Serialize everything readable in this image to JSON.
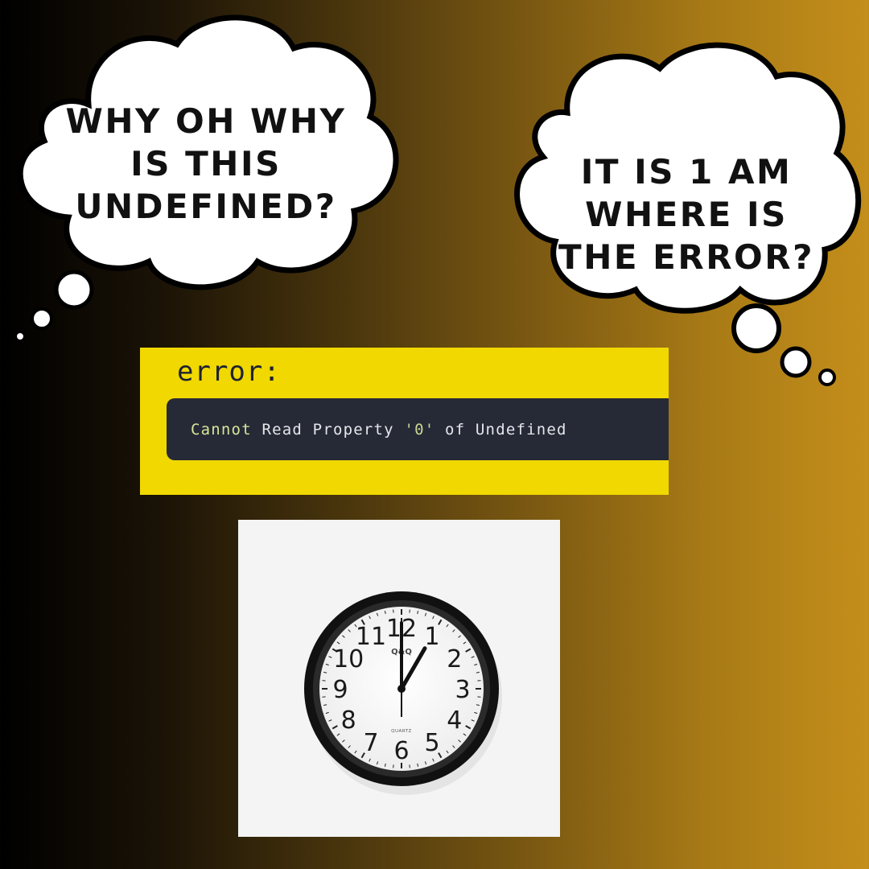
{
  "bubbles": {
    "left": {
      "lines": [
        "WHY OH WHY",
        "IS THIS",
        "UNDEFINED?"
      ]
    },
    "right": {
      "lines": [
        "IT IS 1 AM",
        "WHERE IS",
        "THE ERROR?"
      ]
    }
  },
  "error": {
    "title": "error:",
    "message_parts": [
      "Cannot",
      " Read Property ",
      "'0'",
      " of Undefined"
    ]
  },
  "clock": {
    "brand": "Q&Q",
    "movement": "QUARTZ",
    "numbers": [
      "12",
      "1",
      "2",
      "3",
      "4",
      "5",
      "6",
      "7",
      "8",
      "9",
      "10",
      "11"
    ],
    "time_shown": "1:00"
  },
  "colors": {
    "panel_yellow": "#f0d800",
    "code_bg": "#262a36",
    "gradient_start": "#000000",
    "gradient_end": "#c48e1a"
  }
}
